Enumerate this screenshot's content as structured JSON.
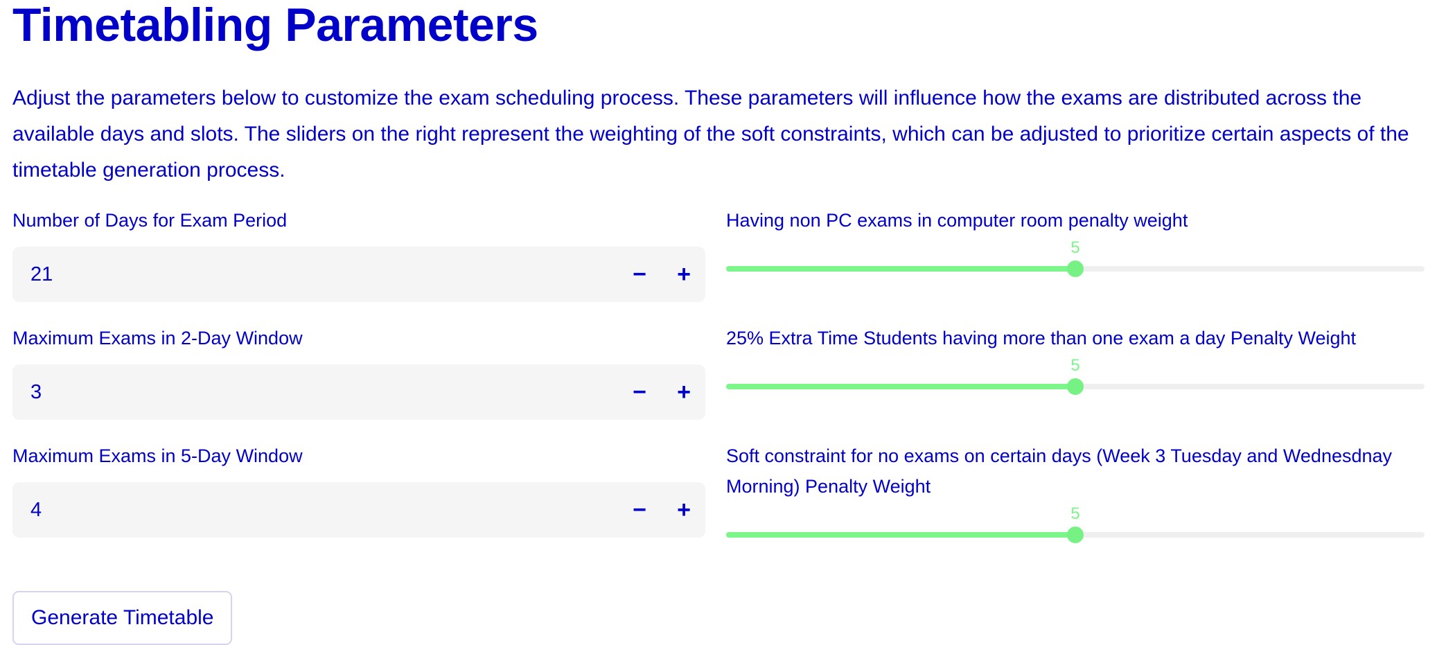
{
  "page": {
    "title": "Timetabling Parameters",
    "description": "Adjust the parameters below to customize the exam scheduling process. These parameters will influence how the exams are distributed across the available days and slots. The sliders on the right represent the weighting of the soft constraints, which can be adjusted to prioritize certain aspects of the timetable generation process."
  },
  "number_inputs": [
    {
      "label": "Number of Days for Exam Period",
      "value": "21",
      "minus_icon": "minus-icon",
      "plus_icon": "plus-icon",
      "minus_glyph": "−",
      "plus_glyph": "+"
    },
    {
      "label": "Maximum Exams in 2-Day Window",
      "value": "3",
      "minus_icon": "minus-icon",
      "plus_icon": "plus-icon",
      "minus_glyph": "−",
      "plus_glyph": "+"
    },
    {
      "label": "Maximum Exams in 5-Day Window",
      "value": "4",
      "minus_icon": "minus-icon",
      "plus_icon": "plus-icon",
      "minus_glyph": "−",
      "plus_glyph": "+"
    }
  ],
  "sliders": [
    {
      "label": "Having non PC exams in computer room penalty weight",
      "value": "5",
      "fraction": 0.5
    },
    {
      "label": "25% Extra Time Students having more than one exam a day Penalty Weight",
      "value": "5",
      "fraction": 0.5
    },
    {
      "label": "Soft constraint for no exams on certain days (Week 3 Tuesday and Wednesdnay Morning) Penalty Weight",
      "value": "5",
      "fraction": 0.5
    }
  ],
  "actions": {
    "generate_label": "Generate Timetable"
  },
  "colors": {
    "text": "#0000c8",
    "slider_accent": "#7cf58a",
    "input_background": "#f5f5f5",
    "track": "#efefef"
  }
}
